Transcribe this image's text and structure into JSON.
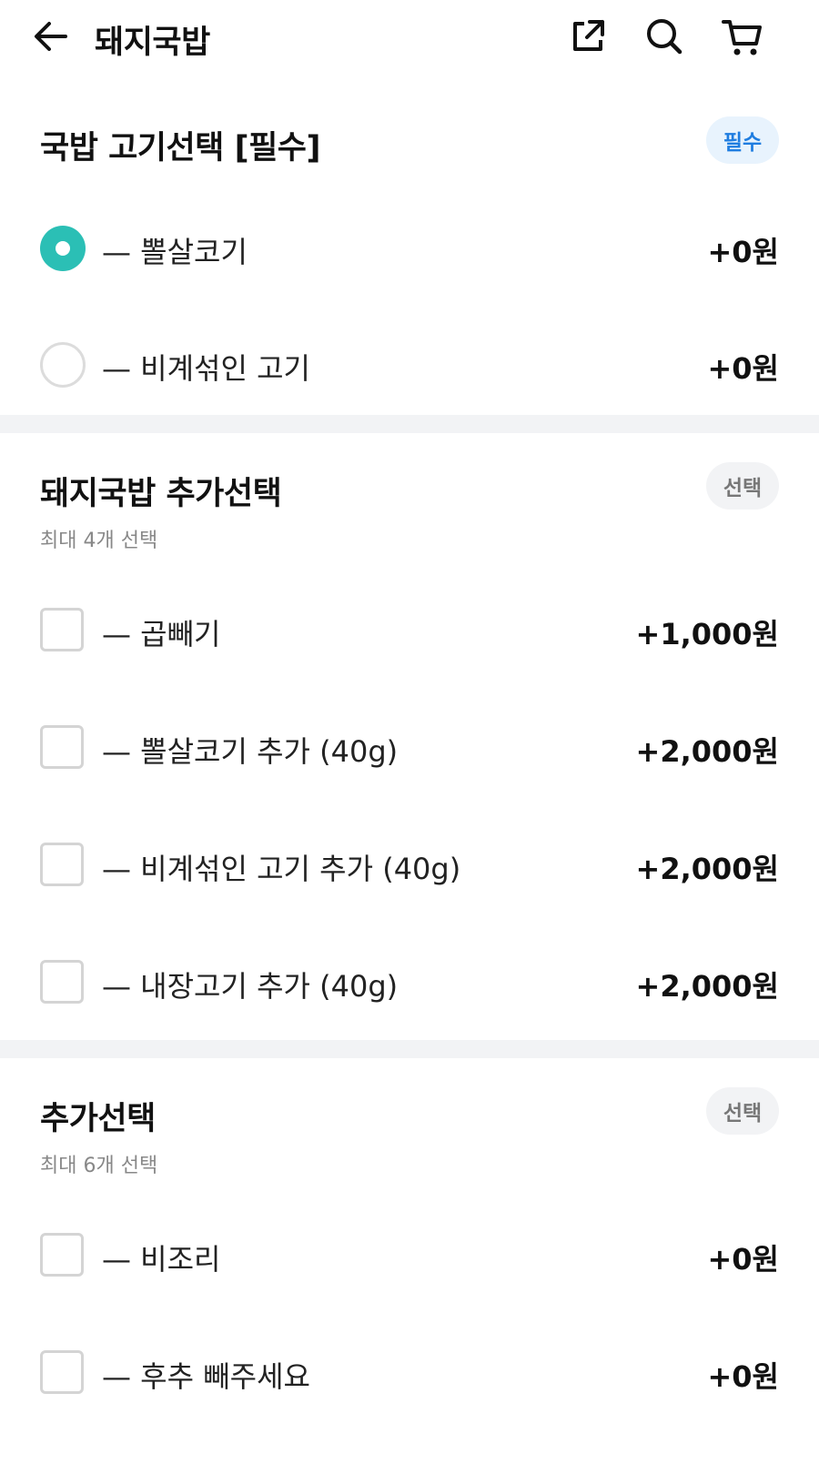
{
  "header": {
    "title": "돼지국밥"
  },
  "sections": [
    {
      "title": "국밥 고기선택 [필수]",
      "badge": "필수",
      "options": [
        {
          "label": "— 뽈살코기",
          "price": "+0원",
          "selected": true
        },
        {
          "label": "— 비계섞인 고기",
          "price": "+0원",
          "selected": false
        }
      ]
    },
    {
      "title": "돼지국밥 추가선택",
      "badge": "선택",
      "subtitle": "최대 4개 선택",
      "options": [
        {
          "label": "— 곱빼기",
          "price": "+1,000원"
        },
        {
          "label": "— 뽈살코기 추가 (40g)",
          "price": "+2,000원"
        },
        {
          "label": "— 비계섞인 고기 추가 (40g)",
          "price": "+2,000원"
        },
        {
          "label": "— 내장고기 추가 (40g)",
          "price": "+2,000원"
        }
      ]
    },
    {
      "title": "추가선택",
      "badge": "선택",
      "subtitle": "최대 6개 선택",
      "options": [
        {
          "label": "— 비조리",
          "price": "+0원"
        },
        {
          "label": "— 후추 빼주세요",
          "price": "+0원"
        }
      ]
    }
  ],
  "colors": {
    "radio_selected": "#2bbfb5",
    "badge_required_text": "#1f7de0",
    "badge_required_bg": "#e8f3fd",
    "badge_optional_text": "#777777",
    "divider": "#f2f3f5"
  }
}
